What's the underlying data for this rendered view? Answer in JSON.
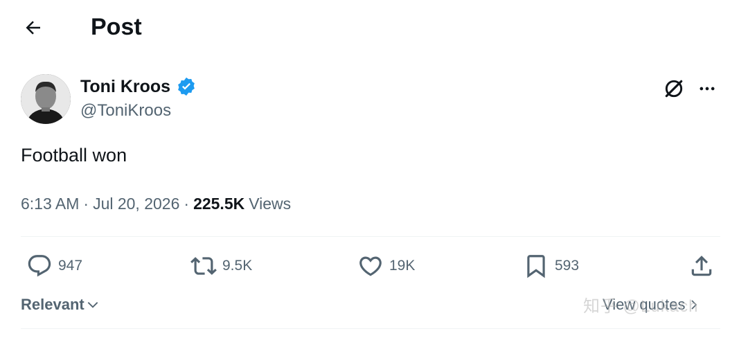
{
  "header": {
    "title": "Post",
    "back_icon": "arrow-left-icon"
  },
  "tweet": {
    "author_name": "Toni Kroos",
    "author_handle": "@ToniKroos",
    "verified": true,
    "verified_color": "#1d9bf0",
    "text": "Football won",
    "time": "6:13 AM",
    "date": "Jul 20, 2026",
    "views_count": "225.5K",
    "views_label": "Views"
  },
  "actions": {
    "replies": "947",
    "reposts": "9.5K",
    "likes": "19K",
    "bookmarks": "593"
  },
  "footer": {
    "sort_label": "Relevant",
    "view_quotes_label": "View quotes",
    "watermark": "知乎 @Lukach"
  },
  "colors": {
    "text": "#0f1419",
    "secondary": "#536471",
    "divider": "#eff3f4"
  }
}
